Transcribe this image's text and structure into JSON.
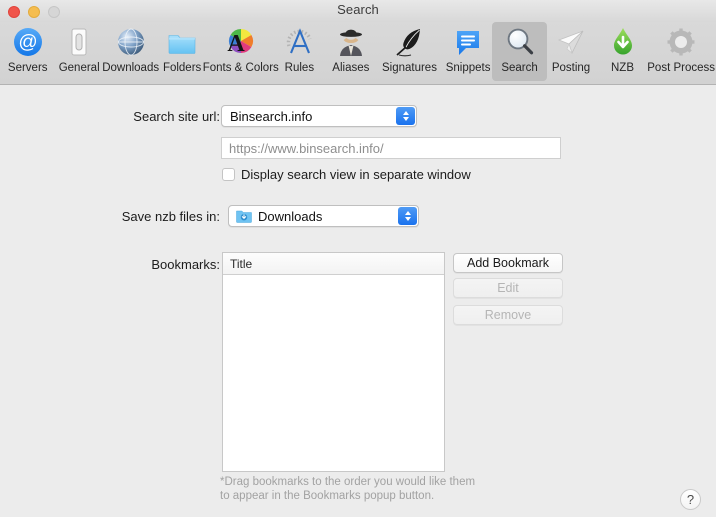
{
  "window": {
    "title": "Search",
    "traffic_lights": [
      "close",
      "minimize",
      "zoom"
    ]
  },
  "toolbar": {
    "selected": "Search",
    "items": [
      {
        "label": "Servers",
        "icon": "at-sign-icon"
      },
      {
        "label": "General",
        "icon": "toggle-switch-icon"
      },
      {
        "label": "Downloads",
        "icon": "globe-icon"
      },
      {
        "label": "Folders",
        "icon": "folder-icon"
      },
      {
        "label": "Fonts & Colors",
        "icon": "font-color-wheel-icon"
      },
      {
        "label": "Rules",
        "icon": "ruler-protractor-icon"
      },
      {
        "label": "Aliases",
        "icon": "spy-person-icon"
      },
      {
        "label": "Signatures",
        "icon": "quill-feather-icon"
      },
      {
        "label": "Snippets",
        "icon": "speech-bubble-icon"
      },
      {
        "label": "Search",
        "icon": "magnifying-glass-icon"
      },
      {
        "label": "Posting",
        "icon": "paper-plane-icon"
      },
      {
        "label": "NZB",
        "icon": "green-download-drop-icon"
      },
      {
        "label": "Post Process",
        "icon": "gear-icon"
      }
    ]
  },
  "form": {
    "search_site_label": "Search site url:",
    "search_site_value": "Binsearch.info",
    "url_field_value": "https://www.binsearch.info/",
    "display_separate_window_label": "Display search view in separate window",
    "display_separate_window_checked": false,
    "save_nzb_label": "Save nzb files in:",
    "save_nzb_value": "Downloads",
    "bookmarks_label": "Bookmarks:",
    "bookmarks_column_header": "Title",
    "bookmarks_rows": [],
    "add_bookmark_label": "Add Bookmark",
    "edit_label": "Edit",
    "remove_label": "Remove",
    "hint_text": "*Drag bookmarks to the order you would like them\nto appear in the Bookmarks popup button."
  },
  "help": {
    "label": "?"
  },
  "colors": {
    "accent_blue": "#1a72ee",
    "window_bg": "#ececec",
    "toolbar_bg": "#d4d4d4",
    "selected_tool_bg": "#bdbdbd",
    "disabled_text": "#b5b5b5",
    "hint_text": "#a2a2a2"
  }
}
